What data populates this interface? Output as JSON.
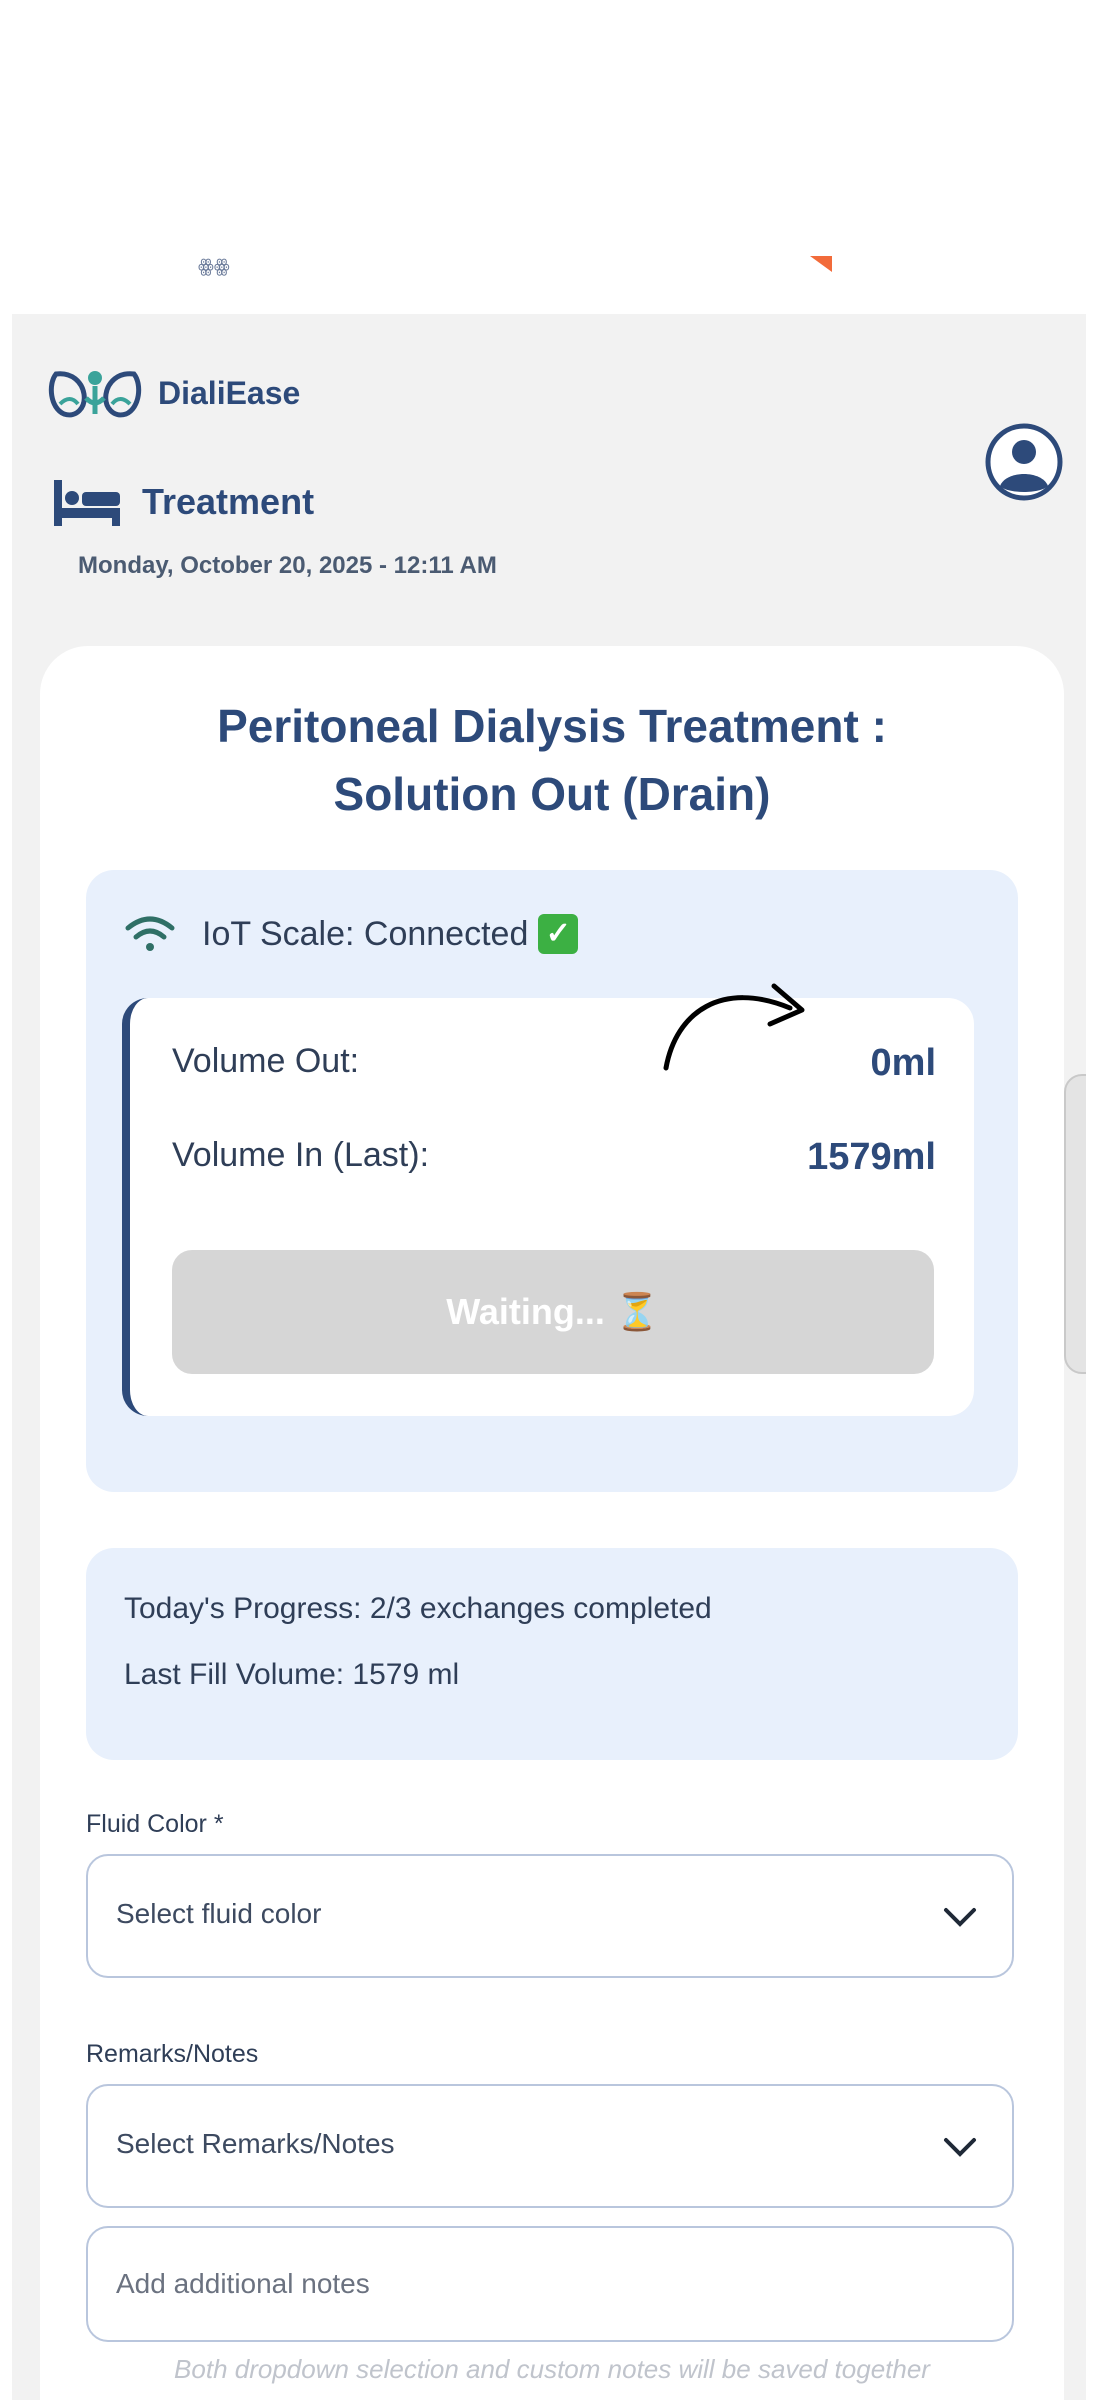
{
  "top_fragment": {
    "left_glyph": "ꙮꙮ"
  },
  "header": {
    "app_name": "DialiEase",
    "section_title": "Treatment",
    "datetime": "Monday, October 20, 2025 - 12:11 AM"
  },
  "card": {
    "title_line1": "Peritoneal Dialysis Treatment :",
    "title_line2": "Solution Out (Drain)",
    "iot_status": "IoT Scale: Connected",
    "volume_out_label": "Volume Out:",
    "volume_out_value": "0ml",
    "volume_in_label": "Volume In (Last):",
    "volume_in_value": "1579ml",
    "waiting_label": "Waiting... ⏳",
    "progress_line": "Today's Progress: 2/3 exchanges completed",
    "last_fill_line": "Last Fill Volume: 1579 ml"
  },
  "form": {
    "fluid_color_label": "Fluid Color *",
    "fluid_color_placeholder": "Select fluid color",
    "remarks_label": "Remarks/Notes",
    "remarks_placeholder": "Select Remarks/Notes",
    "additional_notes_placeholder": "Add additional notes",
    "hint": "Both dropdown selection and custom notes will be saved together"
  },
  "colors": {
    "primary": "#2d4a7a",
    "accent_orange": "#f26b3a",
    "light_blue_bg": "#e8f0fc",
    "success_green": "#3cb043"
  },
  "icons": [
    "logo-icon",
    "bed-icon",
    "user-avatar-icon",
    "wifi-icon",
    "checkmark-icon",
    "hourglass-icon",
    "chevron-down-icon",
    "arrow-icon"
  ]
}
